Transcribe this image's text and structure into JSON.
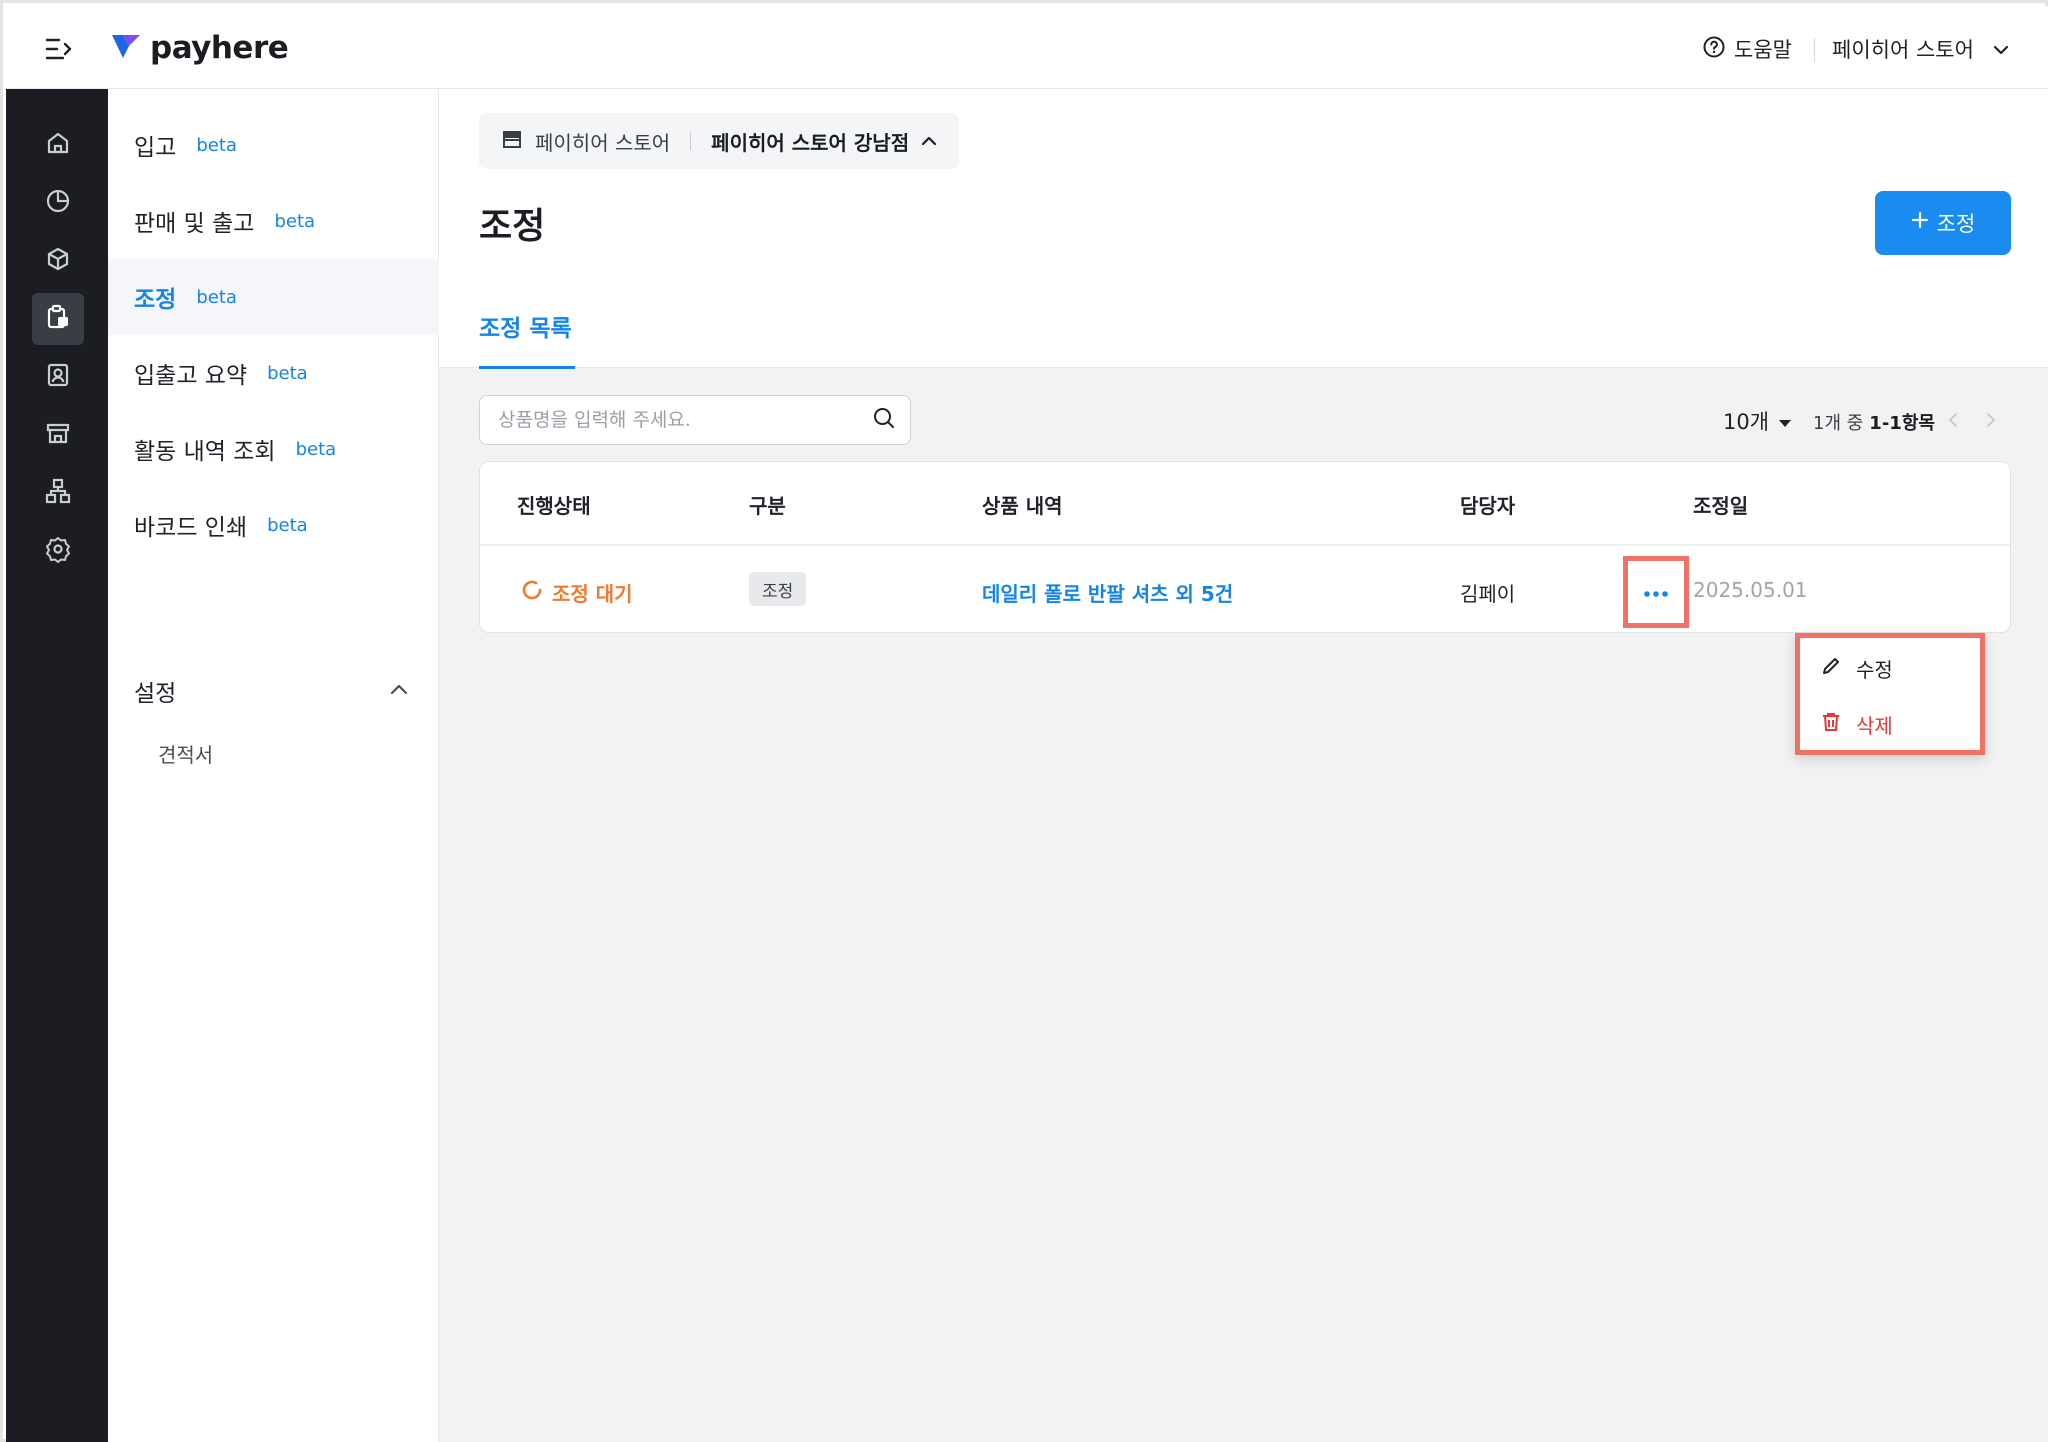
{
  "header": {
    "logo_text": "payhere",
    "help_label": "도움말",
    "store_label": "페이히어 스토어"
  },
  "rail": {
    "icons": [
      "home-icon",
      "chart-icon",
      "box-icon",
      "clipboard-icon",
      "contact-icon",
      "store-icon",
      "org-chart-icon",
      "gear-icon"
    ],
    "active_index": 3
  },
  "subnav": {
    "items": [
      {
        "label": "입고",
        "badge": "beta"
      },
      {
        "label": "판매 및 출고",
        "badge": "beta"
      },
      {
        "label": "조정",
        "badge": "beta"
      },
      {
        "label": "입출고 요약",
        "badge": "beta"
      },
      {
        "label": "활동 내역 조회",
        "badge": "beta"
      },
      {
        "label": "바코드 인쇄",
        "badge": "beta"
      }
    ],
    "active_index": 2,
    "section_label": "설정",
    "section_items": [
      "견적서"
    ]
  },
  "main": {
    "store_chip": {
      "store": "페이히어 스토어",
      "branch": "페이히어 스토어 강남점"
    },
    "title": "조정",
    "add_button_label": "조정",
    "tab_label": "조정 목록",
    "search_placeholder": "상품명을 입력해 주세요.",
    "per_page": "10개",
    "range_prefix": "1개 중",
    "range_value": "1-1항목"
  },
  "table": {
    "columns": [
      "진행상태",
      "구분",
      "상품 내역",
      "담당자",
      "조정일"
    ],
    "rows": [
      {
        "status": "조정 대기",
        "type": "조정",
        "product": "데일리 폴로 반팔 셔츠 외 5건",
        "manager": "김페이",
        "date": "2025.05.01"
      }
    ]
  },
  "popup": {
    "edit_label": "수정",
    "delete_label": "삭제"
  },
  "colors": {
    "accent": "#1485e8",
    "primary_button": "#1a8cf0",
    "status_pending": "#f07a2e",
    "danger": "#e8373b",
    "highlight": "#f07266",
    "rail_bg": "#1b1d22"
  }
}
